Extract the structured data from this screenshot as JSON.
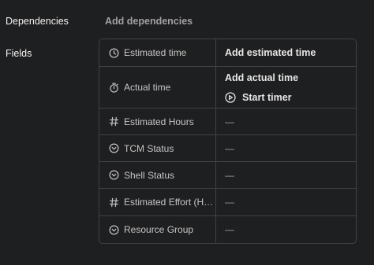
{
  "dependencies": {
    "label": "Dependencies",
    "add_label": "Add dependencies"
  },
  "fields": {
    "label": "Fields",
    "rows": [
      {
        "name": "Estimated time",
        "icon": "clock-icon",
        "value": "Add estimated time"
      },
      {
        "name": "Actual time",
        "icon": "stopwatch-icon",
        "value": "Add actual time",
        "timer_label": "Start timer",
        "timer_icon": "play-circle-icon"
      },
      {
        "name": "Estimated Hours",
        "icon": "number-icon",
        "value": "—"
      },
      {
        "name": "TCM Status",
        "icon": "chevron-circle-icon",
        "value": "—"
      },
      {
        "name": "Shell Status",
        "icon": "chevron-circle-icon",
        "value": "—"
      },
      {
        "name": "Estimated Effort (Ho...",
        "icon": "number-icon",
        "value": "—"
      },
      {
        "name": "Resource Group",
        "icon": "chevron-circle-icon",
        "value": "—"
      }
    ]
  },
  "colors": {
    "background": "#1e1f21",
    "border": "#424244",
    "text": "#f5f4f3",
    "muted": "#a2a0a2"
  }
}
